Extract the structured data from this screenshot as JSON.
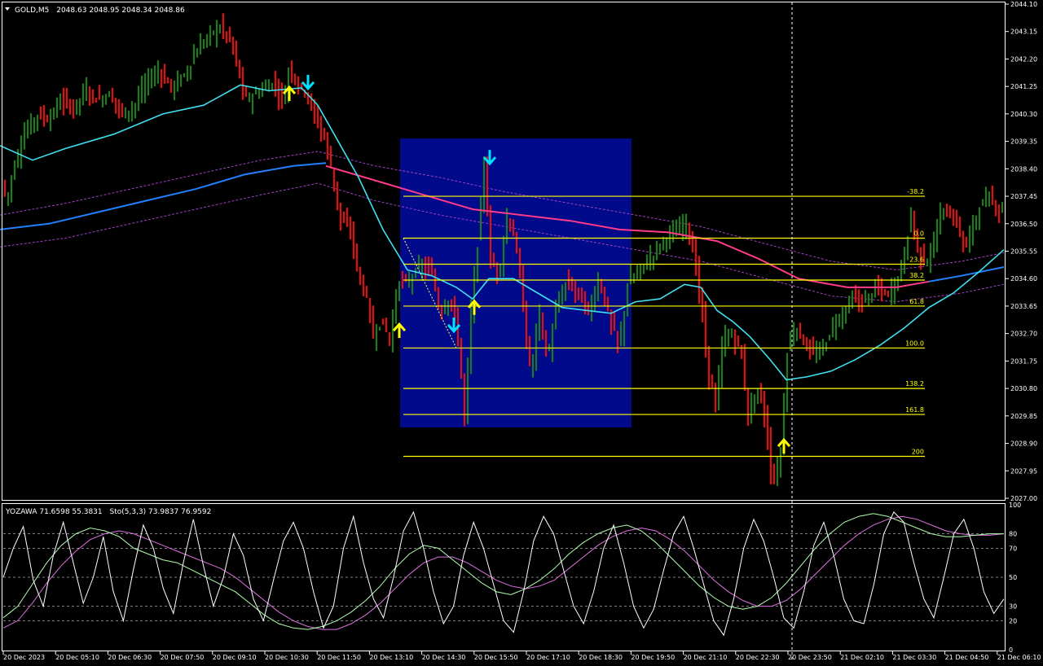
{
  "header": {
    "symbol_label": "GOLD,M5",
    "ohlc": "2048.63 2048.95 2048.34 2048.86"
  },
  "sub_header": {
    "indicator_label": "YOZAWA 71.6598 55.3831",
    "stoch_label": "Sto(5,3,3) 73.9837 76.9592"
  },
  "colors": {
    "background": "#000000",
    "bull_bar": "#1f7a1f",
    "bear_bar": "#e01010",
    "ma_fast": "#40e0f0",
    "ma_slow": "#2080ff",
    "ma_pink": "#ff3b8a",
    "envelope": "#a040c0",
    "fib": "#ffff00",
    "box": "#000a8a",
    "arrow_up": "#ffff00",
    "arrow_down": "#00e0ff"
  },
  "chart_data": [
    {
      "type": "candlestick",
      "title": "GOLD,M5",
      "y_ticks": [
        "2044.10",
        "2043.15",
        "2042.20",
        "2041.25",
        "2040.30",
        "2039.35",
        "2038.40",
        "2037.45",
        "2036.50",
        "2035.55",
        "2034.60",
        "2033.65",
        "2032.70",
        "2031.75",
        "2030.80",
        "2029.85",
        "2028.90",
        "2027.95",
        "2027.00"
      ],
      "ylim": [
        2027.0,
        2044.1
      ],
      "x_ticks": [
        "20 Dec 2023",
        "20 Dec 05:10",
        "20 Dec 06:30",
        "20 Dec 07:50",
        "20 Dec 09:10",
        "20 Dec 10:30",
        "20 Dec 11:50",
        "20 Dec 13:10",
        "20 Dec 14:30",
        "20 Dec 15:50",
        "20 Dec 17:10",
        "20 Dec 18:30",
        "20 Dec 19:50",
        "20 Dec 21:10",
        "20 Dec 22:30",
        "20 Dec 23:50",
        "21 Dec 02:10",
        "21 Dec 03:30",
        "21 Dec 04:50",
        "21 Dec 06:10"
      ],
      "price_path": [
        [
          0,
          2038.2
        ],
        [
          8,
          2037.3
        ],
        [
          18,
          2038.6
        ],
        [
          30,
          2039.6
        ],
        [
          45,
          2040.3
        ],
        [
          60,
          2040.1
        ],
        [
          75,
          2040.8
        ],
        [
          90,
          2040.5
        ],
        [
          105,
          2041.1
        ],
        [
          120,
          2040.8
        ],
        [
          135,
          2041.0
        ],
        [
          150,
          2040.3
        ],
        [
          165,
          2040.6
        ],
        [
          180,
          2041.4
        ],
        [
          195,
          2041.8
        ],
        [
          210,
          2041.2
        ],
        [
          225,
          2041.6
        ],
        [
          240,
          2042.4
        ],
        [
          255,
          2043.0
        ],
        [
          270,
          2043.3
        ],
        [
          282,
          2042.9
        ],
        [
          292,
          2041.9
        ],
        [
          300,
          2040.8
        ],
        [
          310,
          2040.9
        ],
        [
          320,
          2041.1
        ],
        [
          335,
          2041.4
        ],
        [
          348,
          2040.7
        ],
        [
          355,
          2042.0
        ],
        [
          365,
          2041.3
        ],
        [
          375,
          2041.1
        ],
        [
          385,
          2040.3
        ],
        [
          398,
          2039.5
        ],
        [
          408,
          2038.2
        ],
        [
          418,
          2036.6
        ],
        [
          430,
          2036.3
        ],
        [
          440,
          2034.7
        ],
        [
          450,
          2033.9
        ],
        [
          458,
          2032.6
        ],
        [
          468,
          2033.2
        ],
        [
          478,
          2032.5
        ],
        [
          490,
          2034.6
        ],
        [
          500,
          2034.4
        ],
        [
          510,
          2034.9
        ],
        [
          520,
          2035.0
        ],
        [
          530,
          2034.8
        ],
        [
          540,
          2033.4
        ],
        [
          552,
          2034.0
        ],
        [
          562,
          2032.6
        ],
        [
          570,
          2029.8
        ],
        [
          578,
          2033.4
        ],
        [
          586,
          2035.8
        ],
        [
          594,
          2038.6
        ],
        [
          602,
          2035.2
        ],
        [
          612,
          2034.8
        ],
        [
          622,
          2036.7
        ],
        [
          632,
          2036.0
        ],
        [
          642,
          2033.6
        ],
        [
          652,
          2031.0
        ],
        [
          660,
          2033.6
        ],
        [
          672,
          2031.8
        ],
        [
          682,
          2033.5
        ],
        [
          695,
          2034.5
        ],
        [
          710,
          2034.1
        ],
        [
          722,
          2033.4
        ],
        [
          735,
          2034.6
        ],
        [
          748,
          2033.2
        ],
        [
          760,
          2032.2
        ],
        [
          770,
          2034.4
        ],
        [
          785,
          2034.9
        ],
        [
          800,
          2035.4
        ],
        [
          815,
          2036.0
        ],
        [
          830,
          2036.2
        ],
        [
          842,
          2036.6
        ],
        [
          852,
          2035.3
        ],
        [
          860,
          2033.8
        ],
        [
          868,
          2031.6
        ],
        [
          878,
          2030.2
        ],
        [
          888,
          2032.6
        ],
        [
          898,
          2032.6
        ],
        [
          908,
          2032.3
        ],
        [
          918,
          2029.9
        ],
        [
          930,
          2030.8
        ],
        [
          940,
          2029.6
        ],
        [
          948,
          2027.4
        ],
        [
          958,
          2028.6
        ],
        [
          966,
          2032.1
        ],
        [
          976,
          2033.0
        ],
        [
          988,
          2032.3
        ],
        [
          1000,
          2031.9
        ],
        [
          1012,
          2032.3
        ],
        [
          1022,
          2033.0
        ],
        [
          1032,
          2033.3
        ],
        [
          1045,
          2033.9
        ],
        [
          1060,
          2033.8
        ],
        [
          1075,
          2034.3
        ],
        [
          1090,
          2034.0
        ],
        [
          1100,
          2034.5
        ],
        [
          1110,
          2035.4
        ],
        [
          1118,
          2036.9
        ],
        [
          1126,
          2035.6
        ],
        [
          1135,
          2035.2
        ],
        [
          1145,
          2035.6
        ],
        [
          1155,
          2037.0
        ],
        [
          1165,
          2036.8
        ],
        [
          1175,
          2036.5
        ],
        [
          1185,
          2035.6
        ],
        [
          1195,
          2036.6
        ],
        [
          1205,
          2037.2
        ],
        [
          1215,
          2037.4
        ],
        [
          1225,
          2037.0
        ],
        [
          1232,
          2037.0
        ]
      ],
      "ma_fast": [
        [
          0,
          2039.2
        ],
        [
          40,
          2038.7
        ],
        [
          80,
          2039.1
        ],
        [
          140,
          2039.6
        ],
        [
          200,
          2040.3
        ],
        [
          250,
          2040.6
        ],
        [
          295,
          2041.3
        ],
        [
          330,
          2041.1
        ],
        [
          370,
          2041.2
        ],
        [
          390,
          2040.6
        ],
        [
          410,
          2039.6
        ],
        [
          440,
          2038.1
        ],
        [
          470,
          2036.3
        ],
        [
          500,
          2034.9
        ],
        [
          530,
          2034.7
        ],
        [
          560,
          2034.3
        ],
        [
          580,
          2033.9
        ],
        [
          600,
          2034.6
        ],
        [
          630,
          2034.6
        ],
        [
          660,
          2034.1
        ],
        [
          690,
          2033.6
        ],
        [
          720,
          2033.5
        ],
        [
          750,
          2033.4
        ],
        [
          780,
          2033.8
        ],
        [
          810,
          2033.9
        ],
        [
          840,
          2034.4
        ],
        [
          860,
          2034.3
        ],
        [
          880,
          2033.5
        ],
        [
          900,
          2033.1
        ],
        [
          920,
          2032.6
        ],
        [
          945,
          2031.8
        ],
        [
          965,
          2031.1
        ],
        [
          990,
          2031.2
        ],
        [
          1020,
          2031.4
        ],
        [
          1050,
          2031.8
        ],
        [
          1080,
          2032.3
        ],
        [
          1110,
          2032.9
        ],
        [
          1140,
          2033.6
        ],
        [
          1170,
          2034.1
        ],
        [
          1200,
          2034.8
        ],
        [
          1232,
          2035.6
        ]
      ],
      "ma_slow": [
        [
          0,
          2036.3
        ],
        [
          60,
          2036.5
        ],
        [
          120,
          2036.9
        ],
        [
          180,
          2037.3
        ],
        [
          240,
          2037.7
        ],
        [
          300,
          2038.2
        ],
        [
          360,
          2038.5
        ],
        [
          400,
          2038.6
        ]
      ],
      "ma_pink": [
        [
          400,
          2038.5
        ],
        [
          460,
          2038.0
        ],
        [
          520,
          2037.5
        ],
        [
          580,
          2037.0
        ],
        [
          640,
          2036.8
        ],
        [
          700,
          2036.6
        ],
        [
          760,
          2036.3
        ],
        [
          820,
          2036.2
        ],
        [
          880,
          2035.9
        ],
        [
          930,
          2035.3
        ],
        [
          980,
          2034.6
        ],
        [
          1040,
          2034.3
        ],
        [
          1100,
          2034.3
        ],
        [
          1140,
          2034.5
        ]
      ],
      "ma_slow_tail": [
        [
          1140,
          2034.5
        ],
        [
          1180,
          2034.7
        ],
        [
          1232,
          2035.0
        ]
      ],
      "env_upper": [
        [
          0,
          2036.8
        ],
        [
          80,
          2037.2
        ],
        [
          160,
          2037.7
        ],
        [
          240,
          2038.2
        ],
        [
          320,
          2038.7
        ],
        [
          390,
          2039.0
        ],
        [
          460,
          2038.5
        ],
        [
          540,
          2038.1
        ],
        [
          620,
          2037.6
        ],
        [
          700,
          2037.2
        ],
        [
          780,
          2036.8
        ],
        [
          860,
          2036.4
        ],
        [
          940,
          2035.8
        ],
        [
          1020,
          2035.2
        ],
        [
          1100,
          2034.9
        ],
        [
          1180,
          2035.2
        ],
        [
          1232,
          2035.5
        ]
      ],
      "env_lower": [
        [
          0,
          2035.7
        ],
        [
          80,
          2036.0
        ],
        [
          160,
          2036.5
        ],
        [
          240,
          2037.0
        ],
        [
          320,
          2037.5
        ],
        [
          390,
          2037.9
        ],
        [
          460,
          2037.3
        ],
        [
          540,
          2036.8
        ],
        [
          620,
          2036.4
        ],
        [
          700,
          2036.0
        ],
        [
          780,
          2035.6
        ],
        [
          860,
          2035.2
        ],
        [
          940,
          2034.6
        ],
        [
          1020,
          2034.0
        ],
        [
          1100,
          2033.8
        ],
        [
          1180,
          2034.1
        ],
        [
          1232,
          2034.4
        ]
      ],
      "fib_levels": [
        {
          "label": "-38.2",
          "price": 2037.45
        },
        {
          "label": "0.0",
          "price": 2036.0
        },
        {
          "label": "23.6",
          "price": 2035.1
        },
        {
          "label": "38.2",
          "price": 2034.55
        },
        {
          "label": "61.8",
          "price": 2033.65
        },
        {
          "label": "100.0",
          "price": 2032.2
        },
        {
          "label": "138.2",
          "price": 2030.8
        },
        {
          "label": "161.8",
          "price": 2029.9
        },
        {
          "label": "200",
          "price": 2028.45
        }
      ],
      "box": {
        "x0": 491,
        "x1": 775,
        "p0": 2039.45,
        "p1": 2029.45
      },
      "arrows_up": [
        [
          355,
          2041.0
        ],
        [
          490,
          2032.8
        ],
        [
          582,
          2033.6
        ],
        [
          962,
          2028.8
        ]
      ],
      "arrows_down": [
        [
          378,
          2041.4
        ],
        [
          557,
          2033.0
        ],
        [
          601,
          2038.8
        ]
      ],
      "vline_x": 972
    },
    {
      "type": "line",
      "title": "YOZAWA / Sto(5,3,3)",
      "y_ticks": [
        "100",
        "80",
        "70",
        "50",
        "30",
        "20",
        "0"
      ],
      "ylim": [
        0,
        100
      ],
      "fast": [
        50,
        70,
        85,
        48,
        30,
        65,
        88,
        60,
        32,
        50,
        78,
        40,
        20,
        55,
        86,
        70,
        42,
        25,
        60,
        90,
        58,
        30,
        50,
        80,
        65,
        35,
        20,
        48,
        75,
        88,
        70,
        40,
        15,
        30,
        70,
        92,
        60,
        35,
        22,
        50,
        82,
        95,
        70,
        40,
        18,
        30,
        65,
        88,
        70,
        45,
        20,
        12,
        40,
        75,
        92,
        80,
        55,
        30,
        18,
        40,
        70,
        86,
        60,
        30,
        15,
        28,
        55,
        80,
        92,
        70,
        45,
        20,
        10,
        35,
        70,
        90,
        75,
        50,
        22,
        15,
        40,
        72,
        88,
        65,
        35,
        20,
        18,
        45,
        80,
        95,
        88,
        60,
        35,
        22,
        50,
        80,
        90,
        70,
        40,
        25,
        35
      ],
      "slow": [
        22,
        30,
        45,
        60,
        72,
        80,
        84,
        82,
        78,
        70,
        66,
        62,
        60,
        55,
        50,
        45,
        40,
        32,
        24,
        18,
        15,
        14,
        16,
        20,
        26,
        34,
        44,
        56,
        66,
        72,
        70,
        62,
        54,
        46,
        40,
        38,
        42,
        48,
        56,
        66,
        74,
        80,
        84,
        86,
        82,
        74,
        64,
        54,
        44,
        36,
        30,
        28,
        30,
        36,
        46,
        58,
        70,
        80,
        88,
        92,
        94,
        92,
        88,
        84,
        80,
        78,
        78,
        79,
        80,
        80
      ],
      "sig": [
        15,
        20,
        32,
        46,
        58,
        68,
        76,
        80,
        82,
        80,
        76,
        72,
        68,
        64,
        60,
        56,
        50,
        42,
        34,
        26,
        20,
        16,
        14,
        14,
        18,
        24,
        32,
        42,
        52,
        60,
        64,
        64,
        60,
        54,
        48,
        44,
        42,
        44,
        48,
        56,
        64,
        72,
        78,
        82,
        84,
        82,
        76,
        68,
        58,
        48,
        40,
        34,
        30,
        30,
        34,
        42,
        52,
        62,
        72,
        80,
        86,
        90,
        92,
        90,
        86,
        82,
        80,
        79,
        79,
        80
      ]
    }
  ]
}
